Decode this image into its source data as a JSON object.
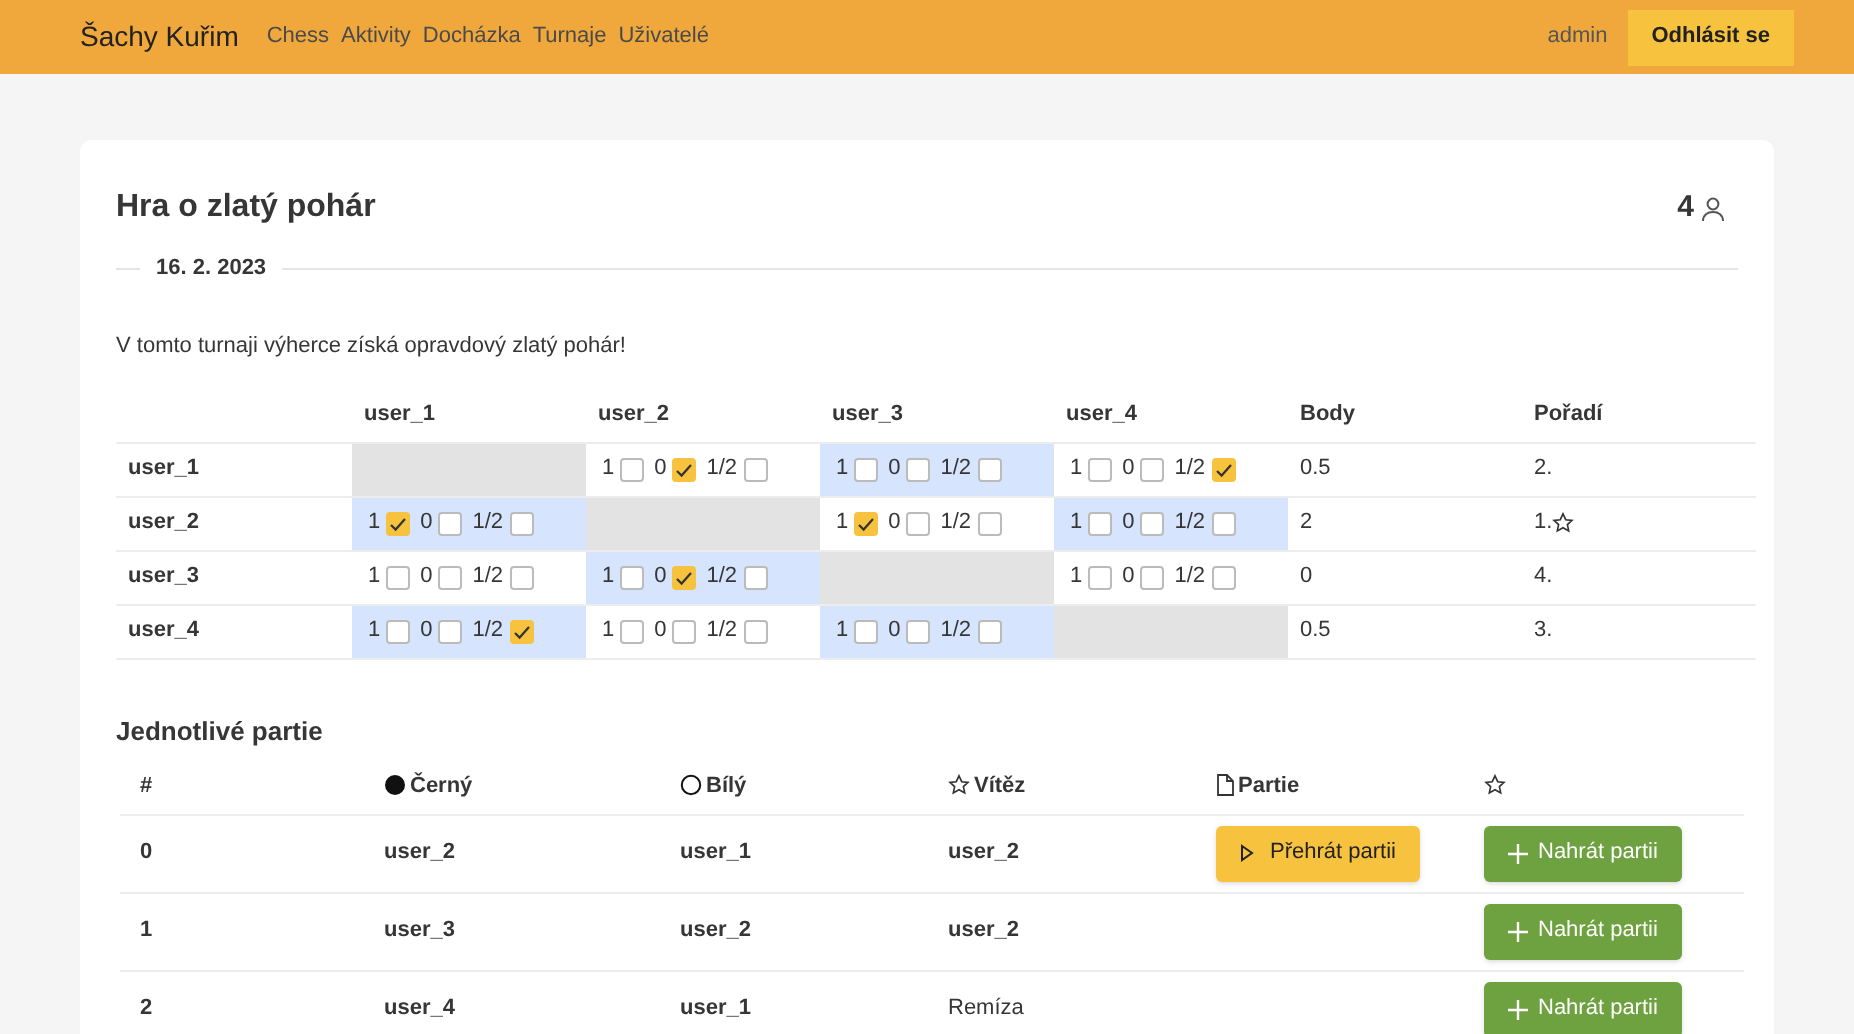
{
  "nav": {
    "brand": "Šachy Kuřim",
    "links": [
      "Chess",
      "Aktivity",
      "Docházka",
      "Turnaje",
      "Uživatelé"
    ],
    "user": "admin",
    "logout": "Odhlásit se"
  },
  "tournament": {
    "title": "Hra o zlatý pohár",
    "players_count": "4",
    "date": "16. 2. 2023",
    "description": "V tomto turnaji výherce získá opravdový zlatý pohár!"
  },
  "crosstable": {
    "columns": [
      "user_1",
      "user_2",
      "user_3",
      "user_4",
      "Body",
      "Pořadí"
    ],
    "rows": [
      {
        "player": "user_1",
        "cells": [
          {
            "kind": "self"
          },
          {
            "kind": "result",
            "highlighted": false,
            "options": [
              {
                "label": "1",
                "checked": false
              },
              {
                "label": "0",
                "checked": true
              },
              {
                "label": "1/2",
                "checked": false
              }
            ]
          },
          {
            "kind": "result",
            "highlighted": true,
            "options": [
              {
                "label": "1",
                "checked": false
              },
              {
                "label": "0",
                "checked": false
              },
              {
                "label": "1/2",
                "checked": false
              }
            ]
          },
          {
            "kind": "result",
            "highlighted": false,
            "options": [
              {
                "label": "1",
                "checked": false
              },
              {
                "label": "0",
                "checked": false
              },
              {
                "label": "1/2",
                "checked": true
              }
            ]
          }
        ],
        "points": "0.5",
        "rank": "2.",
        "winner": false
      },
      {
        "player": "user_2",
        "cells": [
          {
            "kind": "result",
            "highlighted": true,
            "options": [
              {
                "label": "1",
                "checked": true
              },
              {
                "label": "0",
                "checked": false
              },
              {
                "label": "1/2",
                "checked": false
              }
            ]
          },
          {
            "kind": "self"
          },
          {
            "kind": "result",
            "highlighted": false,
            "options": [
              {
                "label": "1",
                "checked": true
              },
              {
                "label": "0",
                "checked": false
              },
              {
                "label": "1/2",
                "checked": false
              }
            ]
          },
          {
            "kind": "result",
            "highlighted": true,
            "options": [
              {
                "label": "1",
                "checked": false
              },
              {
                "label": "0",
                "checked": false
              },
              {
                "label": "1/2",
                "checked": false
              }
            ]
          }
        ],
        "points": "2",
        "rank": "1.",
        "winner": true
      },
      {
        "player": "user_3",
        "cells": [
          {
            "kind": "result",
            "highlighted": false,
            "options": [
              {
                "label": "1",
                "checked": false
              },
              {
                "label": "0",
                "checked": false
              },
              {
                "label": "1/2",
                "checked": false
              }
            ]
          },
          {
            "kind": "result",
            "highlighted": true,
            "options": [
              {
                "label": "1",
                "checked": false
              },
              {
                "label": "0",
                "checked": true
              },
              {
                "label": "1/2",
                "checked": false
              }
            ]
          },
          {
            "kind": "self"
          },
          {
            "kind": "result",
            "highlighted": false,
            "options": [
              {
                "label": "1",
                "checked": false
              },
              {
                "label": "0",
                "checked": false
              },
              {
                "label": "1/2",
                "checked": false
              }
            ]
          }
        ],
        "points": "0",
        "rank": "4.",
        "winner": false
      },
      {
        "player": "user_4",
        "cells": [
          {
            "kind": "result",
            "highlighted": true,
            "options": [
              {
                "label": "1",
                "checked": false
              },
              {
                "label": "0",
                "checked": false
              },
              {
                "label": "1/2",
                "checked": true
              }
            ]
          },
          {
            "kind": "result",
            "highlighted": false,
            "options": [
              {
                "label": "1",
                "checked": false
              },
              {
                "label": "0",
                "checked": false
              },
              {
                "label": "1/2",
                "checked": false
              }
            ]
          },
          {
            "kind": "result",
            "highlighted": true,
            "options": [
              {
                "label": "1",
                "checked": false
              },
              {
                "label": "0",
                "checked": false
              },
              {
                "label": "1/2",
                "checked": false
              }
            ]
          },
          {
            "kind": "self"
          }
        ],
        "points": "0.5",
        "rank": "3.",
        "winner": false
      }
    ]
  },
  "games": {
    "title": "Jednotlivé partie",
    "columns": [
      "#",
      "Černý",
      "Bílý",
      "Vítěz",
      "Partie"
    ],
    "rows": [
      {
        "number": "0",
        "black": "user_2",
        "white": "user_1",
        "result": "user_2",
        "draw": false,
        "replay": "Přehrát partii",
        "upload": "Nahrát partii"
      },
      {
        "number": "1",
        "black": "user_3",
        "white": "user_2",
        "result": "user_2",
        "draw": false,
        "upload": "Nahrát partii"
      },
      {
        "number": "2",
        "black": "user_4",
        "white": "user_1",
        "result": "Remíza",
        "draw": true,
        "upload": "Nahrát partii"
      }
    ]
  }
}
